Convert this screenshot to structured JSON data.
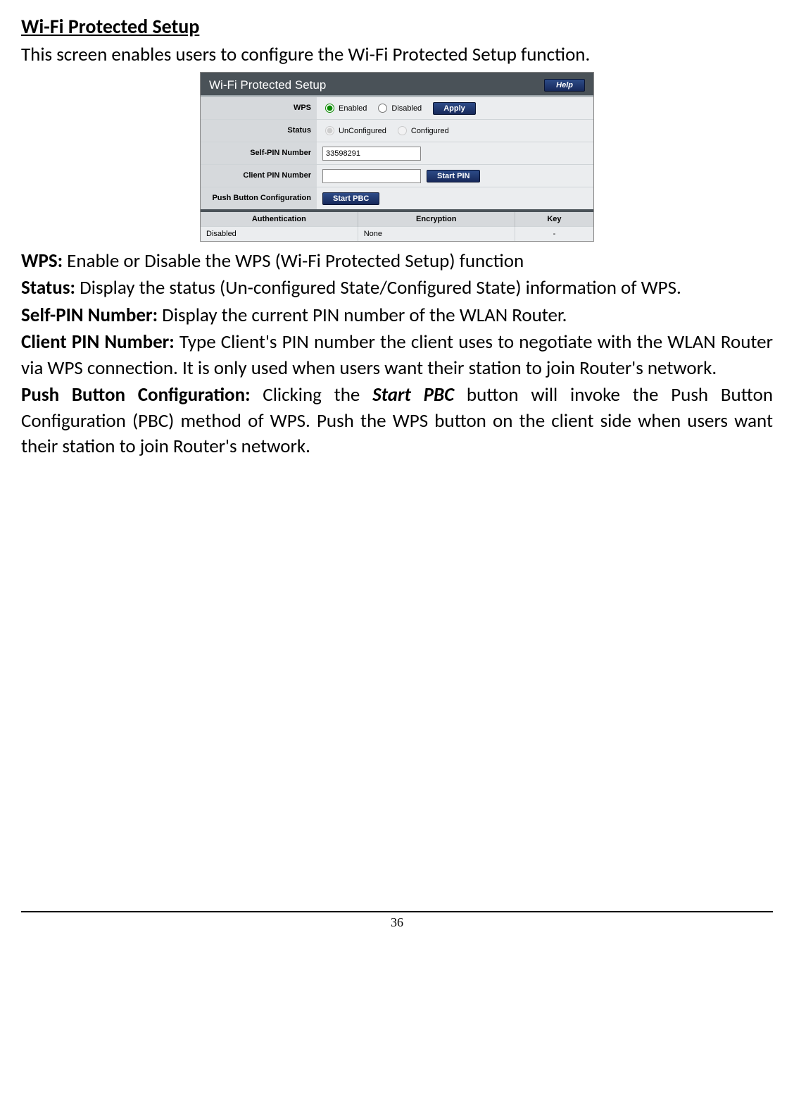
{
  "doc": {
    "sectionTitle": "Wi-Fi Protected Setup",
    "intro": "This screen enables users to configure the Wi-Fi Protected Setup function.",
    "panelTitle": "Wi-Fi Protected Setup",
    "helpLabel": "Help",
    "labels": {
      "wps": "WPS",
      "status": "Status",
      "selfPin": "Self-PIN Number",
      "clientPin": "Client PIN Number",
      "pbc": "Push Button Configuration"
    },
    "options": {
      "enabled": "Enabled",
      "disabled": "Disabled",
      "unconfigured": "UnConfigured",
      "configured": "Configured"
    },
    "buttons": {
      "apply": "Apply",
      "startPin": "Start PIN",
      "startPbc": "Start PBC"
    },
    "values": {
      "selfPin": "33598291",
      "clientPin": ""
    },
    "tableHeaders": {
      "auth": "Authentication",
      "enc": "Encryption",
      "key": "Key"
    },
    "tableRow": {
      "auth": "Disabled",
      "enc": "None",
      "key": "-"
    },
    "descriptions": {
      "wpsLabel": "WPS:",
      "wpsText": " Enable or Disable the WPS (Wi-Fi Protected Setup) function",
      "statusLabel": "Status:",
      "statusText": " Display the status (Un-configured State/Configured State) information of WPS.",
      "selfPinLabel": "Self-PIN Number:",
      "selfPinText": " Display the current PIN number of the WLAN Router.",
      "clientPinLabel": "Client PIN Number:",
      "clientPinText": " Type Client's PIN number the client uses to negotiate with the WLAN Router via WPS connection. It is only used when users want their station to join Router's network.",
      "pbcLabel": "Push Button Configuration:",
      "pbcText1": " Clicking the ",
      "pbcBold": "Start PBC",
      "pbcText2": " button will invoke the Push Button Configuration (PBC) method of WPS. Push the WPS button on the client side when users want their station to join Router's network."
    },
    "pageNumber": "36"
  }
}
